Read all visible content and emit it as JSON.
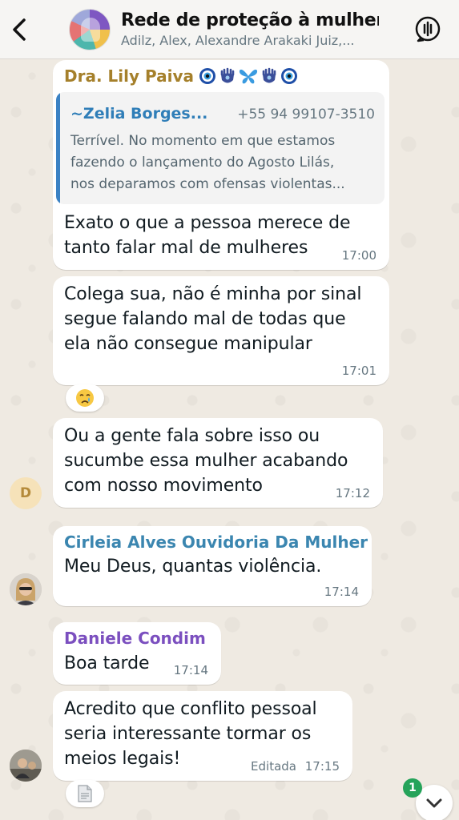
{
  "header": {
    "title": "Rede de proteção à mulher",
    "members": "Adilz, Alex, Alexandre Arakaki Juiz,..."
  },
  "messages": [
    {
      "sender": "Dra. Lily Paiva",
      "sender_color": "#a5802b",
      "quote": {
        "name": "~Zelia Borges...",
        "phone": "+55 94 99107-3510",
        "text": "Terrível. No momento em que estamos\nfazendo o lançamento do Agosto Lilás,\nnos deparamos com ofensas violentas..."
      },
      "text": "Exato o que a pessoa merece de\ntanto falar mal de mulheres",
      "time": "17:00"
    },
    {
      "text": "Colega sua, não é minha por sinal\nsegue falando mal de todas que\nela não consegue manipular",
      "time": "17:01",
      "reaction": "😢"
    },
    {
      "avatar_letter": "D",
      "text": "Ou a gente fala sobre isso ou\nsucumbe essa mulher acabando\ncom nosso movimento",
      "time": "17:12"
    },
    {
      "sender": "Cirleia Alves Ouvidoria Da Mulher",
      "sender_color": "#3b86b0",
      "text": "Meu Deus, quantas violência.",
      "time": "17:14"
    },
    {
      "sender": "Daniele Condim",
      "sender_color": "#7b4fbf",
      "text": "Boa tarde",
      "time": "17:14"
    },
    {
      "text": "Acredito que conflito pessoal\nseria interessante tormar os\nmeios legais!",
      "edited_label": "Editada",
      "time": "17:15"
    }
  ],
  "unread_count": "1",
  "colors": {
    "chat_background": "#efeae2",
    "bubble": "#ffffff",
    "quote_accent": "#3b82c4",
    "badge": "#25a35a"
  }
}
